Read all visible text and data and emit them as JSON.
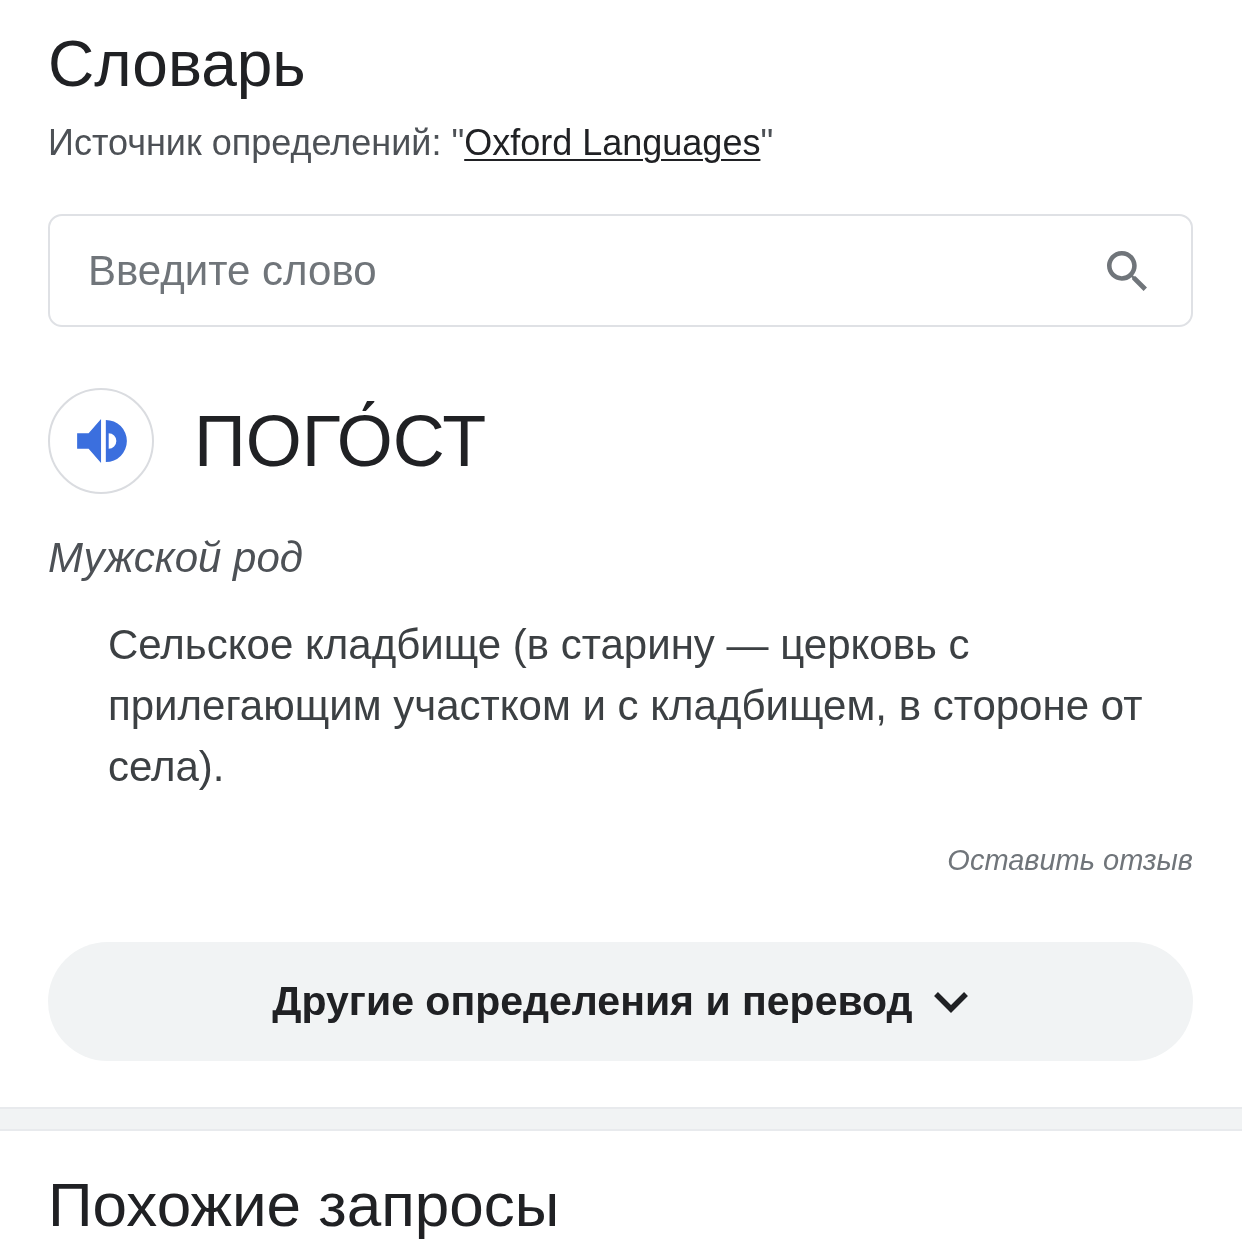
{
  "dictionary": {
    "title": "Словарь",
    "source": {
      "prefix": "Источник определений: \"",
      "link": "Oxford Languages",
      "suffix": "\""
    },
    "search": {
      "placeholder": "Введите слово"
    },
    "entry": {
      "word": "ПОГО́СТ",
      "part_of_speech": "Мужской род",
      "definitions": [
        "Сельское кладбище (в старину — церковь с прилегающим участком и с кладбищем, в стороне от села)."
      ],
      "feedback": "Оставить отзыв"
    },
    "more_button": {
      "label": "Другие определения и перевод",
      "expanded": false
    }
  },
  "related_searches": {
    "title": "Похожие запросы"
  }
}
